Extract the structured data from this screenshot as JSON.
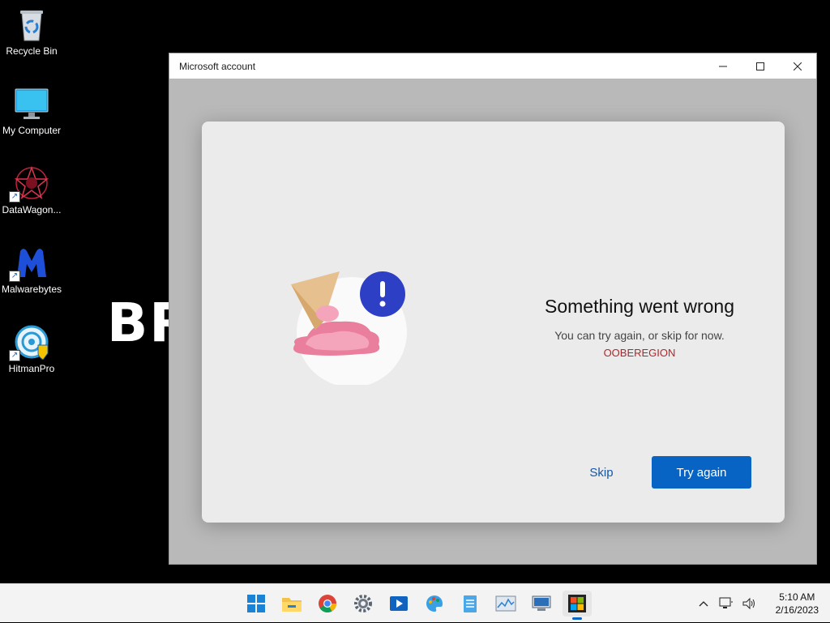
{
  "desktop": {
    "icons": [
      {
        "label": "Recycle Bin"
      },
      {
        "label": "My Computer"
      },
      {
        "label": "DataWagon..."
      },
      {
        "label": "Malwarebytes"
      },
      {
        "label": "HitmanPro"
      }
    ],
    "wallpaper_text": "BR"
  },
  "window": {
    "title": "Microsoft account",
    "dialog": {
      "heading": "Something went wrong",
      "subtext": "You can try again, or skip for now.",
      "error_code": "OOBEREGION",
      "skip_label": "Skip",
      "try_again_label": "Try again"
    }
  },
  "taskbar": {
    "apps": [
      "start",
      "file-explorer",
      "chrome",
      "settings",
      "media-player",
      "paint",
      "notepad",
      "resource-monitor",
      "remote-desktop",
      "microsoft-store"
    ],
    "time": "5:10 AM",
    "date": "2/16/2023"
  },
  "colors": {
    "accent": "#0763c4",
    "error": "#b0262b"
  }
}
